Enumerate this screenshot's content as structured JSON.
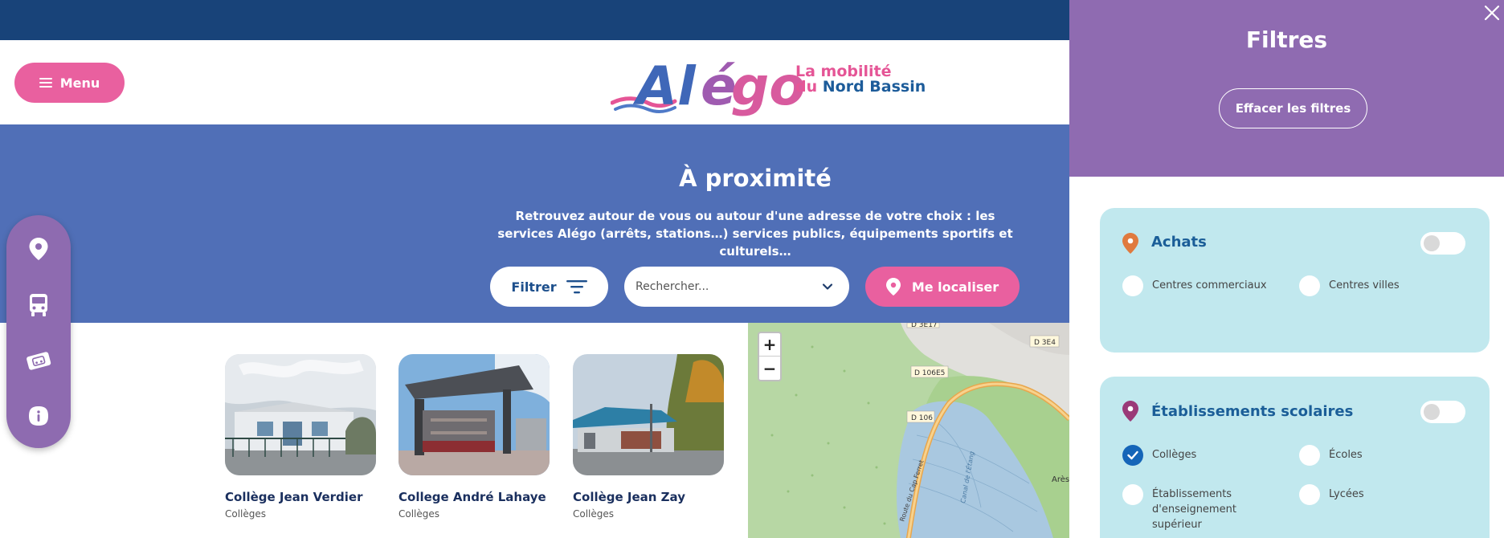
{
  "header": {
    "menu_label": "Menu",
    "logo_word": "Alégo",
    "tagline_line1": "La mobilité",
    "tagline_line2_a": "du",
    "tagline_line2_b": "Nord Bassin"
  },
  "hero": {
    "title": "À proximité",
    "description": "Retrouvez autour de vous ou autour d'une adresse de votre choix : les services Alégo (arrêts, stations…) services publics, équipements sportifs et culturels…",
    "filter_label": "Filtrer",
    "search_placeholder": "Rechercher...",
    "locate_label": "Me localiser"
  },
  "sidenav": {
    "items": [
      {
        "icon": "map-pin-icon"
      },
      {
        "icon": "bus-icon"
      },
      {
        "icon": "ticket-icon"
      },
      {
        "icon": "info-icon"
      }
    ]
  },
  "cards": [
    {
      "name": "Collège Jean Verdier",
      "category": "Collèges"
    },
    {
      "name": "College André Lahaye",
      "category": "Collèges"
    },
    {
      "name": "Collège Jean Zay",
      "category": "Collèges"
    }
  ],
  "map": {
    "zoom_in": "+",
    "zoom_out": "−",
    "labels": [
      "D 3E17",
      "D 3E4",
      "D 106E5",
      "D 106",
      "Route du Cap Ferret",
      "Canal de l'Étang",
      "Arès"
    ]
  },
  "filters": {
    "title": "Filtres",
    "clear_label": "Effacer les filtres",
    "groups": [
      {
        "title": "Achats",
        "pin_color": "#e07a3e",
        "options": [
          {
            "label": "Centres commerciaux",
            "checked": false
          },
          {
            "label": "Centres villes",
            "checked": false
          }
        ]
      },
      {
        "title": "Établissements scolaires",
        "pin_color": "#9a3a78",
        "options": [
          {
            "label": "Collèges",
            "checked": true
          },
          {
            "label": "Écoles",
            "checked": false
          },
          {
            "label": "Établissements d'enseignement supérieur",
            "checked": false
          },
          {
            "label": "Lycées",
            "checked": false
          }
        ]
      }
    ]
  },
  "colors": {
    "top_bar": "#184379",
    "hero": "#506fb7",
    "pink": "#e9609f",
    "purple": "#8f6bb1",
    "filter_box": "#c1e8ee"
  }
}
